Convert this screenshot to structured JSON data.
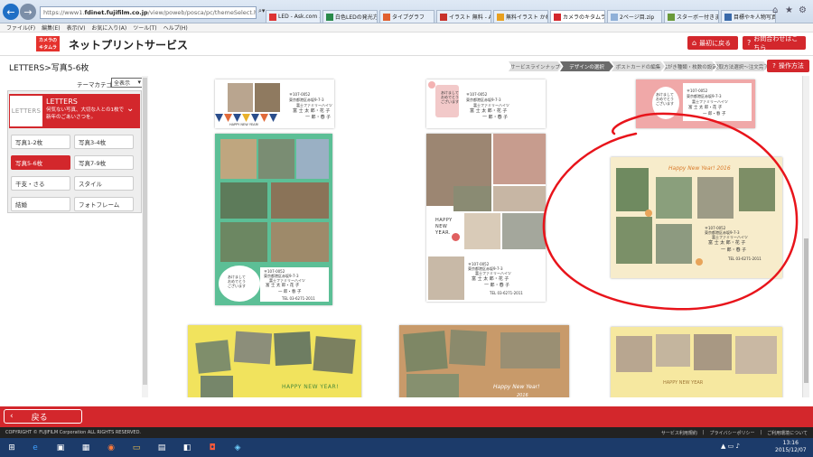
{
  "browser": {
    "url_prefix": "https://www1.",
    "url_domain": "fdinet.fujifilm.co.jp",
    "url_path": "/view/poweb/posca/pc/themeSelect.htm",
    "tabs": [
      "LED - Ask.com ...",
      "白色LEDの発光方...",
      "タイプグラフ",
      "イラスト 無料 - A...",
      "無料イラスト かわい...",
      "カメラのキタムラ...",
      "2ページ目.zip",
      "スターボー付きまくれ...",
      "目標やキ人物写真..."
    ],
    "active_tab": 5,
    "menu": [
      "ファイル(F)",
      "編集(E)",
      "表示(V)",
      "お気に入り(A)",
      "ツール(T)",
      "ヘルプ(H)"
    ]
  },
  "header": {
    "logo_line1": "カメラの",
    "logo_line2": "キタムラ",
    "title": "ネットプリントサービス",
    "btn_top": "最初に戻る",
    "btn_contact": "お問合わせはこちら"
  },
  "breadcrumb": "LETTERS>写真5-6枚",
  "steps": [
    "サービスラインナップ",
    "デザインの選択",
    "ポストカードの編集",
    "はがき種類・枚数の設定",
    "受取方法選択〜注文完了"
  ],
  "current_step": 1,
  "howto": "操作方法",
  "category": {
    "label": "テーマカテゴリ",
    "selected": "全表示"
  },
  "letters": {
    "logo": "LETTERS",
    "title": "LETTERS",
    "desc": "何気ない写真、大切な人との1枚で新年のごあいさつを。"
  },
  "categories": [
    "写真1-2枚",
    "写真3-4枚",
    "写真5-6枚",
    "写真7-9枚",
    "干支・さる",
    "スタイル",
    "結婚",
    "フォトフレーム"
  ],
  "selected_category": 2,
  "cards": {
    "greeting_happy": "HAPPY NEW YEAR!",
    "greeting_happy2": "HAPPY NEW YEAR",
    "greeting_cursive": "Happy New Year! 2016",
    "greeting_cursive2": "Happy New Year!",
    "greeting_year": "2016",
    "happy": "HAPPY",
    "new": "NEW",
    "year": "YEAR.",
    "postal": "〒107-0052",
    "address": "東京都港区赤坂9-7-3",
    "building": "富士ファミリーハイツ",
    "names1": "富 士 太 郎・花 子",
    "names2": "一 郎・春 子",
    "tel": "TEL 03-6271-2011",
    "kana": "あけまして\nおめでとう\nございます"
  },
  "footer": {
    "back": "戻る",
    "copyright": "COPYRIGHT © FUJIFILM Corporation ALL RIGHTS RESERVED.",
    "links": [
      "サービス利用規約",
      "プライバシーポリシー",
      "ご利用環境について"
    ]
  },
  "taskbar": {
    "time": "13:16",
    "date": "2015/12/07"
  },
  "colors": {
    "brand_red": "#d3272c",
    "annotation_red": "#e8141b",
    "panel_bg": "#eeeeee"
  }
}
